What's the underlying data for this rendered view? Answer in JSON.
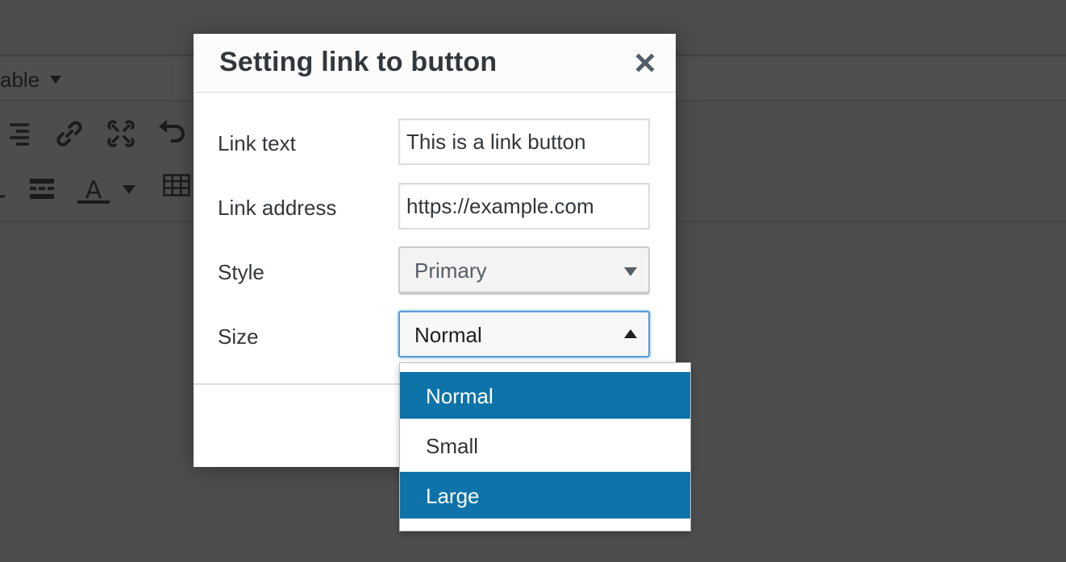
{
  "background": {
    "menu_text": "able",
    "toolbar_icons": [
      "align-right-icon",
      "link-icon",
      "unlink-icon",
      "undo-icon",
      "horizontal-line-icon",
      "text-color-icon",
      "table-icon"
    ]
  },
  "dialog": {
    "title": "Setting link to button",
    "close_icon": "close-icon",
    "fields": {
      "link_text": {
        "label": "Link text",
        "value": "This is a link button"
      },
      "link_address": {
        "label": "Link address",
        "value": "https://example.com"
      },
      "style": {
        "label": "Style",
        "selected": "Primary"
      },
      "size": {
        "label": "Size",
        "selected": "Normal"
      }
    }
  },
  "size_dropdown": {
    "options": [
      "Normal",
      "Small",
      "Large"
    ],
    "highlight_color": "#0e73a8"
  }
}
